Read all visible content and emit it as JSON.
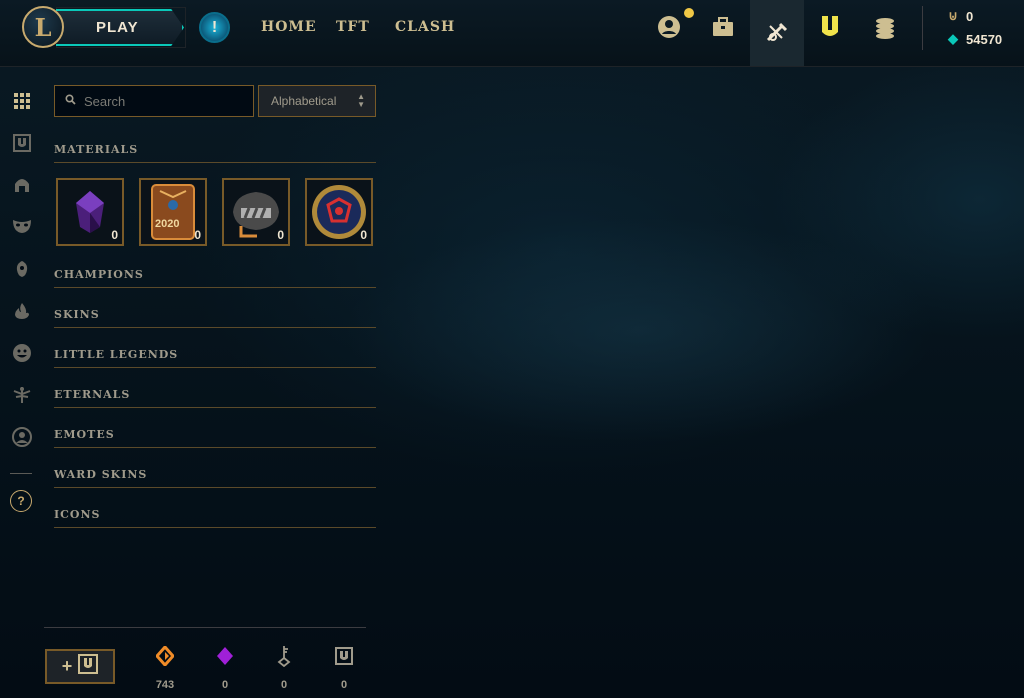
{
  "topbar": {
    "logo_letter": "L",
    "play_label": "PLAY",
    "alert_symbol": "!",
    "nav": [
      "HOME",
      "TFT",
      "CLASH"
    ],
    "blue_essence": "0",
    "riot_points": "54570"
  },
  "search": {
    "placeholder": "Search"
  },
  "sort": {
    "selected": "Alphabetical"
  },
  "sections": {
    "materials": "MATERIALS",
    "champions": "CHAMPIONS",
    "skins": "SKINS",
    "little_legends": "LITTLE LEGENDS",
    "eternals": "ETERNALS",
    "emotes": "EMOTES",
    "ward_skins": "WARD SKINS",
    "icons": "ICONS"
  },
  "materials": [
    {
      "name": "crystal-shard",
      "count": "0"
    },
    {
      "name": "year-2020-token",
      "label": "2020",
      "count": "0"
    },
    {
      "name": "chest",
      "count": "0"
    },
    {
      "name": "emblem-orb",
      "count": "0"
    }
  ],
  "footer": {
    "craft_plus": "+",
    "orange_essence": "743",
    "mythic_essence": "0",
    "keys": "0",
    "loot_tokens": "0"
  },
  "colors": {
    "gold": "#c8aa6e",
    "teal": "#0ac8b9",
    "orange": "#f08c28",
    "purple": "#a020d8"
  }
}
